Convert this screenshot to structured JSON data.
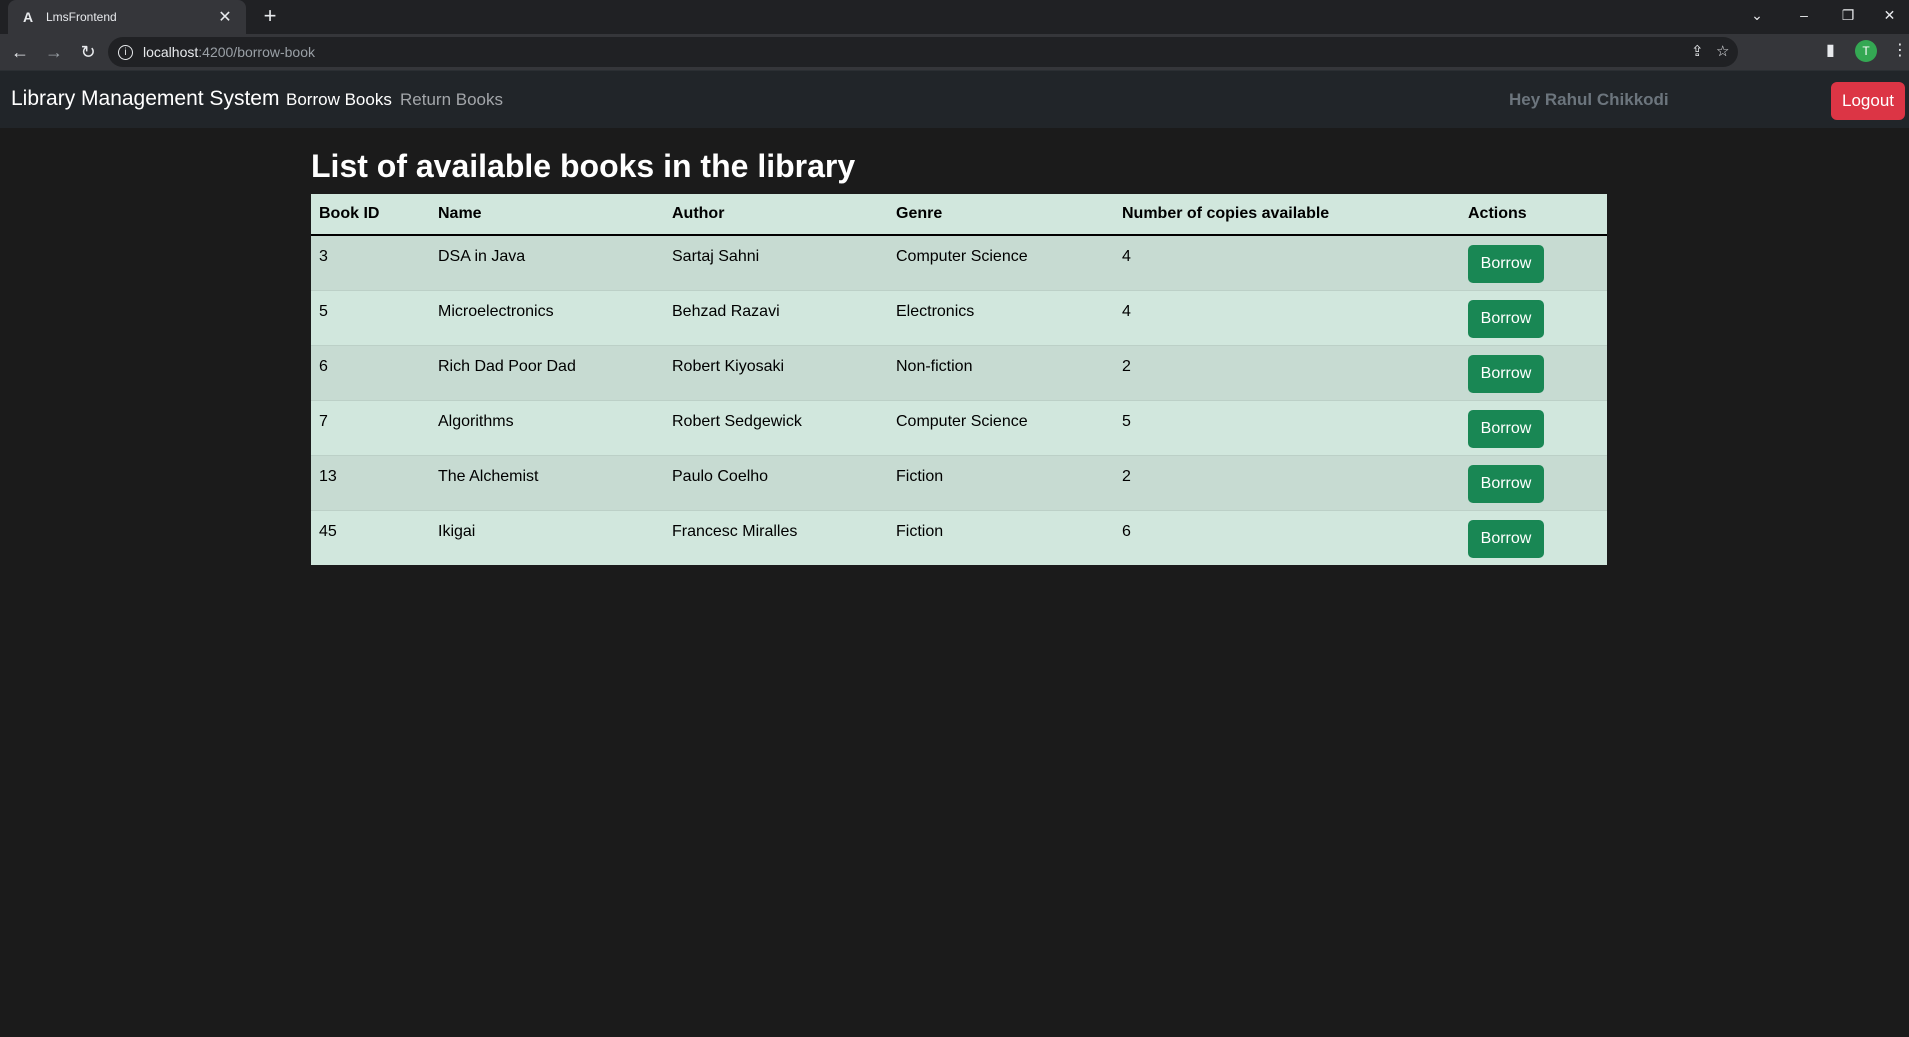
{
  "browser": {
    "tab_title": "LmsFrontend",
    "favicon_letter": "A",
    "url_host": "localhost",
    "url_path": ":4200/borrow-book",
    "profile_initial": "T"
  },
  "navbar": {
    "brand": "Library Management System",
    "links": [
      {
        "label": "Borrow Books",
        "active": true
      },
      {
        "label": "Return Books",
        "active": false
      }
    ],
    "greeting": "Hey Rahul Chikkodi",
    "logout_label": "Logout"
  },
  "page": {
    "heading": "List of available books in the library",
    "columns": [
      "Book ID",
      "Name",
      "Author",
      "Genre",
      "Number of copies available",
      "Actions"
    ],
    "rows": [
      {
        "id": "3",
        "name": "DSA in Java",
        "author": "Sartaj Sahni",
        "genre": "Computer Science",
        "copies": "4",
        "action": "Borrow"
      },
      {
        "id": "5",
        "name": "Microelectronics",
        "author": "Behzad Razavi",
        "genre": "Electronics",
        "copies": "4",
        "action": "Borrow"
      },
      {
        "id": "6",
        "name": "Rich Dad Poor Dad",
        "author": "Robert Kiyosaki",
        "genre": "Non-fiction",
        "copies": "2",
        "action": "Borrow"
      },
      {
        "id": "7",
        "name": "Algorithms",
        "author": "Robert Sedgewick",
        "genre": "Computer Science",
        "copies": "5",
        "action": "Borrow"
      },
      {
        "id": "13",
        "name": "The Alchemist",
        "author": "Paulo Coelho",
        "genre": "Fiction",
        "copies": "2",
        "action": "Borrow"
      },
      {
        "id": "45",
        "name": "Ikigai",
        "author": "Francesc Miralles",
        "genre": "Fiction",
        "copies": "6",
        "action": "Borrow"
      }
    ]
  },
  "colors": {
    "navbar_bg": "#212529",
    "logout_bg": "#dc3545",
    "borrow_bg": "#198754",
    "table_bg": "#d1e7dd"
  }
}
